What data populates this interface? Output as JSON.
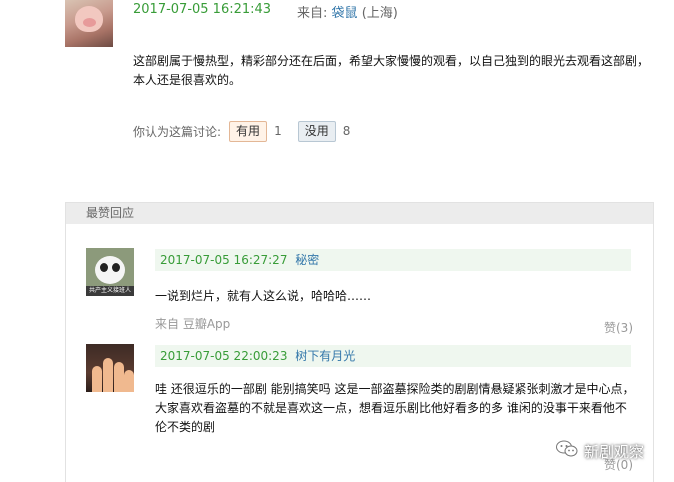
{
  "post": {
    "date": "2017-07-05 16:21:43",
    "from_label": "来自:",
    "author": "袋鼠",
    "location": "(上海)",
    "body": "这部剧属于慢热型，精彩部分还在后面，希望大家慢慢的观看，以自己独到的眼光去观看这部剧，本人还是很喜欢的。",
    "vote_prompt": "你认为这篇讨论:",
    "useful_label": "有用",
    "useful_count": "1",
    "useless_label": "没用",
    "useless_count": "8"
  },
  "replies_section": {
    "header": "最赞回应",
    "replies": [
      {
        "date": "2017-07-05 16:27:27",
        "user": "秘密",
        "avatar_caption": "共产主义接班人",
        "text": "一说到烂片，就有人这么说，哈哈哈……",
        "source": "来自 豆瓣App",
        "like_label": "赞(3)"
      },
      {
        "date": "2017-07-05 22:00:23",
        "user": "树下有月光",
        "text": "哇 还很逗乐的一部剧 能别搞笑吗 这是一部盗墓探险类的剧剧情悬疑紧张刺激才是中心点，大家喜欢看盗墓的不就是喜欢这一点，想看逗乐剧比他好看多的多 谁闲的没事干来看他不伦不类的剧",
        "like_label": "赞(0)"
      }
    ]
  },
  "watermark": {
    "icon": "wechat-icon",
    "text": "新剧观察"
  }
}
